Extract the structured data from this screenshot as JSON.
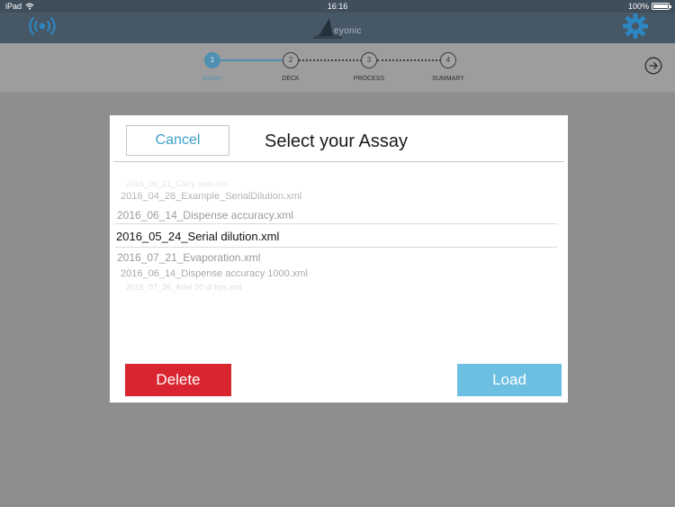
{
  "status_bar": {
    "device": "iPad",
    "time": "16:16",
    "battery_text": "100%",
    "battery_level": 1.0
  },
  "header": {
    "logo_text": "eyonic",
    "broadcast_icon": "broadcast-icon",
    "settings_icon": "gear-icon",
    "accent_color": "#2e86c1"
  },
  "stepper": {
    "active_index": 0,
    "next_icon": "arrow-right-circle-icon",
    "steps": [
      {
        "number": "1",
        "label": "ASSAY"
      },
      {
        "number": "2",
        "label": "DECK"
      },
      {
        "number": "3",
        "label": "PROCESS"
      },
      {
        "number": "4",
        "label": "SUMMARY"
      }
    ]
  },
  "dialog": {
    "title": "Select your Assay",
    "cancel_label": "Cancel",
    "delete_label": "Delete",
    "load_label": "Load",
    "delete_color": "#d9252f",
    "load_color": "#6cbfe1",
    "selected_index": 3,
    "files": [
      "2016_06_21_Carry over.xml",
      "2016_04_28_Example_SerialDilution.xml",
      "2016_06_14_Dispense accuracy.xml",
      "2016_05_24_Serial dilution.xml",
      "2016_07_21_Evaporation.xml",
      "2016_06_14_Dispense accuracy 1000.xml",
      "2016_07_26_Artel 20 ul tips.xml"
    ]
  }
}
